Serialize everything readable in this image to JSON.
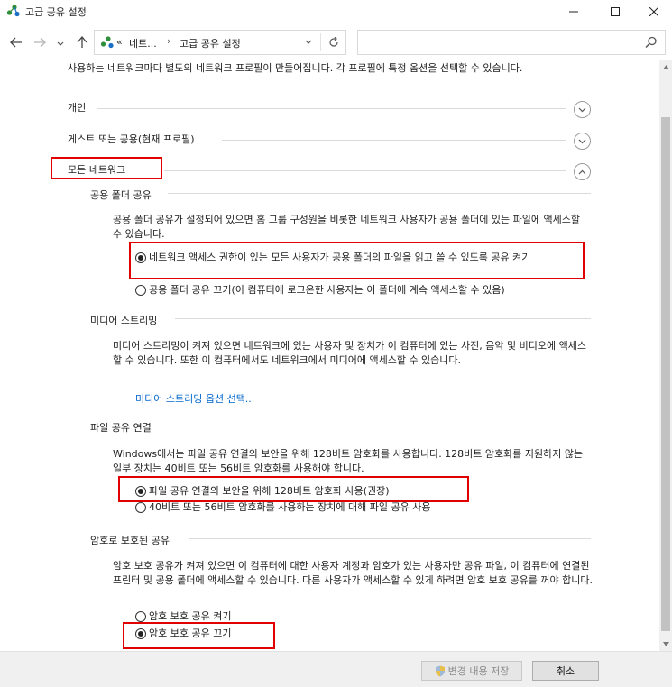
{
  "window": {
    "title": "고급 공유 설정"
  },
  "nav": {
    "crumb_prefix": "«",
    "crumb_1": "네트...",
    "crumb_2": "고급 공유 설정",
    "search_placeholder": ""
  },
  "intro": "사용하는 네트워크마다 별도의 네트워크 프로필이 만들어집니다. 각 프로필에 특정 옵션을 선택할 수 있습니다.",
  "profiles": {
    "private": "개인",
    "guest": "게스트 또는 공용(현재 프로필)",
    "all": "모든 네트워크"
  },
  "public_folder": {
    "heading": "공용 폴더 공유",
    "description": "공용 폴더 공유가 설정되어 있으면 홈 그룹 구성원을 비롯한 네트워크 사용자가 공용 폴더에 있는 파일에 액세스할 수 있습니다.",
    "option_on": "네트워크 액세스 권한이 있는 모든 사용자가 공용 폴더의 파일을 읽고 쓸 수 있도록 공유 켜기",
    "option_off": "공용 폴더 공유 끄기(이 컴퓨터에 로그온한 사용자는 이 폴더에 계속 액세스할 수 있음)",
    "selected": "on"
  },
  "media": {
    "heading": "미디어 스트리밍",
    "description": "미디어 스트리밍이 켜져 있으면 네트워크에 있는 사용자 및 장치가 이 컴퓨터에 있는 사진, 음악 및 비디오에 액세스할 수 있습니다. 또한 이 컴퓨터에서도 네트워크에서 미디어에 액세스할 수 있습니다.",
    "link": "미디어 스트리밍 옵션 선택..."
  },
  "file_sharing": {
    "heading": "파일 공유 연결",
    "description": "Windows에서는 파일 공유 연결의 보안을 위해 128비트 암호화를 사용합니다. 128비트 암호화를 지원하지 않는 일부 장치는 40비트 또는 56비트 암호화를 사용해야 합니다.",
    "option_128": "파일 공유 연결의 보안을 위해 128비트 암호화 사용(권장)",
    "option_40_56": "40비트 또는 56비트 암호화를 사용하는 장치에 대해 파일 공유 사용",
    "selected": "128"
  },
  "password": {
    "heading": "암호로 보호된 공유",
    "description": "암호 보호 공유가 켜져 있으면 이 컴퓨터에 대한 사용자 계정과 암호가 있는 사용자만 공유 파일, 이 컴퓨터에 연결된 프린터 및 공용 폴더에 액세스할 수 있습니다. 다른 사용자가 액세스할 수 있게 하려면 암호 보호 공유를 꺼야 합니다.",
    "option_on": "암호 보호 공유 켜기",
    "option_off": "암호 보호 공유 끄기",
    "selected": "off"
  },
  "footer": {
    "save": "변경 내용 저장",
    "cancel": "취소"
  },
  "colors": {
    "highlight": "#e00000",
    "link": "#0066cc",
    "footer_bg": "#f0f0f0"
  }
}
